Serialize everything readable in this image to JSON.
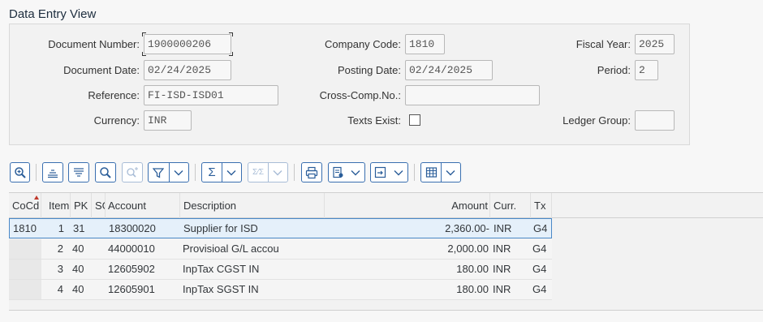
{
  "page": {
    "title": "Data Entry View"
  },
  "header": {
    "document_number": {
      "label": "Document Number:",
      "value": "1900000206"
    },
    "company_code": {
      "label": "Company Code:",
      "value": "1810"
    },
    "fiscal_year": {
      "label": "Fiscal Year:",
      "value": "2025"
    },
    "document_date": {
      "label": "Document Date:",
      "value": "02/24/2025"
    },
    "posting_date": {
      "label": "Posting Date:",
      "value": "02/24/2025"
    },
    "period": {
      "label": "Period:",
      "value": "2"
    },
    "reference": {
      "label": "Reference:",
      "value": "FI-ISD-ISD01"
    },
    "cross_comp": {
      "label": "Cross-Comp.No.:",
      "value": ""
    },
    "currency": {
      "label": "Currency:",
      "value": "INR"
    },
    "texts_exist": {
      "label": "Texts Exist:",
      "checked": false
    },
    "ledger_group": {
      "label": "Ledger Group:",
      "value": ""
    }
  },
  "toolbar": {
    "icons": [
      "zoom-in-icon",
      "sort-ascending-icon",
      "sort-descending-icon",
      "search-icon",
      "search-next-icon",
      "filter-icon",
      "sum-icon",
      "subtotal-icon",
      "print-icon",
      "export-icon",
      "layout-icon",
      "grid-layout-icon"
    ],
    "accent": "#2a5d99"
  },
  "grid": {
    "columns": [
      "CoCd",
      "Item",
      "PK",
      "SG",
      "Account",
      "Description",
      "Amount",
      "Curr.",
      "Tx"
    ],
    "rows": [
      {
        "cocd": "1810",
        "item": "1",
        "pk": "31",
        "sg": "",
        "account": "18300020",
        "description": "Supplier for ISD",
        "amount": "2,360.00-",
        "curr": "INR",
        "tx": "G4"
      },
      {
        "cocd": "",
        "item": "2",
        "pk": "40",
        "sg": "",
        "account": "44000010",
        "description": "Provisioal G/L accou",
        "amount": "2,000.00",
        "curr": "INR",
        "tx": "G4"
      },
      {
        "cocd": "",
        "item": "3",
        "pk": "40",
        "sg": "",
        "account": "12605902",
        "description": "InpTax CGST IN",
        "amount": "180.00",
        "curr": "INR",
        "tx": "G4"
      },
      {
        "cocd": "",
        "item": "4",
        "pk": "40",
        "sg": "",
        "account": "12605901",
        "description": "InpTax SGST IN",
        "amount": "180.00",
        "curr": "INR",
        "tx": "G4"
      }
    ]
  }
}
